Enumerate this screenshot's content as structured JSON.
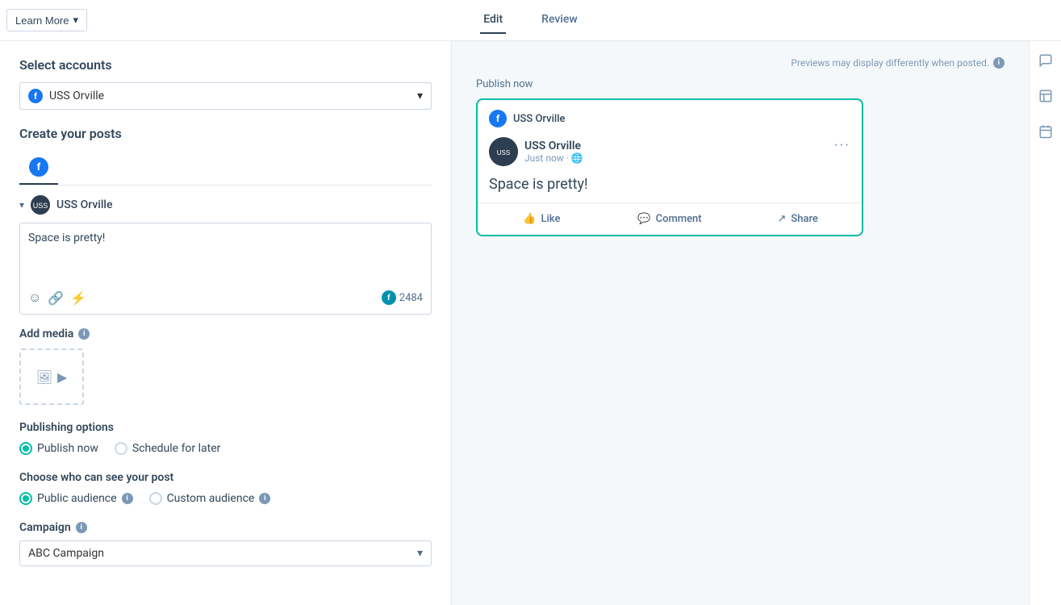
{
  "topbar": {
    "learn_more_label": "Learn More",
    "tabs": [
      {
        "id": "edit",
        "label": "Edit",
        "active": true
      },
      {
        "id": "review",
        "label": "Review",
        "active": false
      }
    ]
  },
  "left": {
    "select_accounts_title": "Select accounts",
    "account_name": "USS Orville",
    "create_posts_title": "Create your posts",
    "account_section": {
      "name": "USS Orville",
      "post_text": "Space is pretty!",
      "char_count": "2484"
    },
    "add_media_label": "Add media",
    "publishing_options": {
      "title": "Publishing options",
      "options": [
        {
          "id": "publish_now",
          "label": "Publish now",
          "selected": true
        },
        {
          "id": "schedule",
          "label": "Schedule for later",
          "selected": false
        }
      ]
    },
    "audience": {
      "title": "Choose who can see your post",
      "options": [
        {
          "id": "public",
          "label": "Public audience",
          "selected": true
        },
        {
          "id": "custom",
          "label": "Custom audience",
          "selected": false
        }
      ]
    },
    "campaign": {
      "label": "Campaign",
      "value": "ABC Campaign"
    }
  },
  "right": {
    "preview_note": "Previews may display differently when posted.",
    "publish_now_label": "Publish now",
    "fb_preview": {
      "page_name_header": "USS Orville",
      "account_name": "USS Orville",
      "time": "Just now · 🌐",
      "post_text": "Space is pretty!",
      "actions": [
        {
          "id": "like",
          "label": "Like",
          "icon": "👍"
        },
        {
          "id": "comment",
          "label": "Comment",
          "icon": "💬"
        },
        {
          "id": "share",
          "label": "Share",
          "icon": "↗"
        }
      ]
    }
  },
  "right_sidebar": {
    "icons": [
      {
        "id": "chat-bubbles-icon",
        "symbol": "💬"
      },
      {
        "id": "calendar-icon",
        "symbol": "📋"
      },
      {
        "id": "schedule-icon",
        "symbol": "📅"
      }
    ]
  }
}
